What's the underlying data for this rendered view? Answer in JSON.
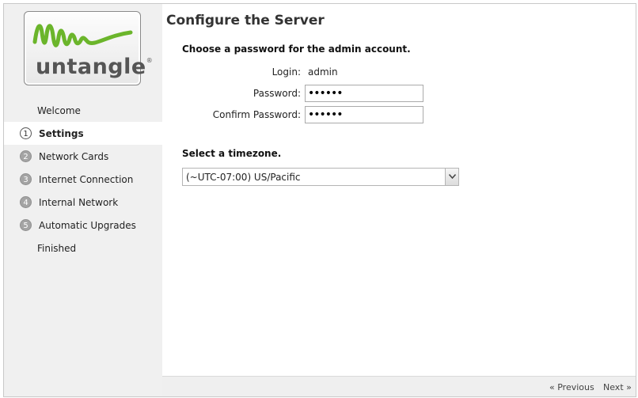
{
  "brand": {
    "logo_text": "untangle",
    "logo_mark": "®",
    "logo_color": "#6bb52b"
  },
  "steps": [
    {
      "label": "Welcome",
      "number": ""
    },
    {
      "label": "Settings",
      "number": "1",
      "active": true
    },
    {
      "label": "Network Cards",
      "number": "2"
    },
    {
      "label": "Internet Connection",
      "number": "3"
    },
    {
      "label": "Internal Network",
      "number": "4"
    },
    {
      "label": "Automatic Upgrades",
      "number": "5"
    },
    {
      "label": "Finished",
      "number": ""
    }
  ],
  "main": {
    "title": "Configure the Server",
    "password_section": "Choose a password for the admin account.",
    "login_label": "Login:",
    "login_value": "admin",
    "password_label": "Password:",
    "password_value": "••••••",
    "confirm_label": "Confirm Password:",
    "confirm_value": "••••••",
    "timezone_section": "Select a timezone.",
    "timezone_value": "(~UTC-07:00) US/Pacific"
  },
  "footer": {
    "previous": "« Previous",
    "next": "Next »"
  }
}
